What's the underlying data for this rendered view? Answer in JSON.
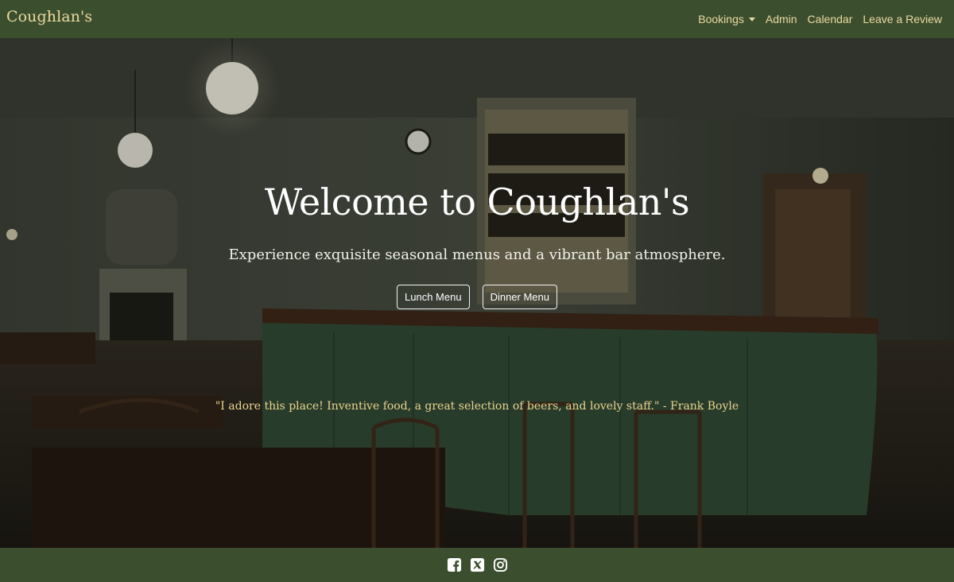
{
  "brand": "Coughlan's",
  "nav": {
    "bookings": "Bookings",
    "admin": "Admin",
    "calendar": "Calendar",
    "review": "Leave a Review"
  },
  "hero": {
    "title": "Welcome to Coughlan's",
    "subtitle": "Experience exquisite seasonal menus and a vibrant bar atmosphere.",
    "buttons": {
      "lunch": "Lunch Menu",
      "dinner": "Dinner Menu"
    },
    "quote": "\"I adore this place! Inventive food, a great selection of beers, and lovely staff.\" - Frank Boyle"
  },
  "footer": {
    "icons": [
      "facebook-icon",
      "x-twitter-icon",
      "instagram-icon"
    ]
  },
  "colors": {
    "nav_bg": "#3b4f2f",
    "accent": "#ecd9a0",
    "quote": "#ead38e"
  }
}
